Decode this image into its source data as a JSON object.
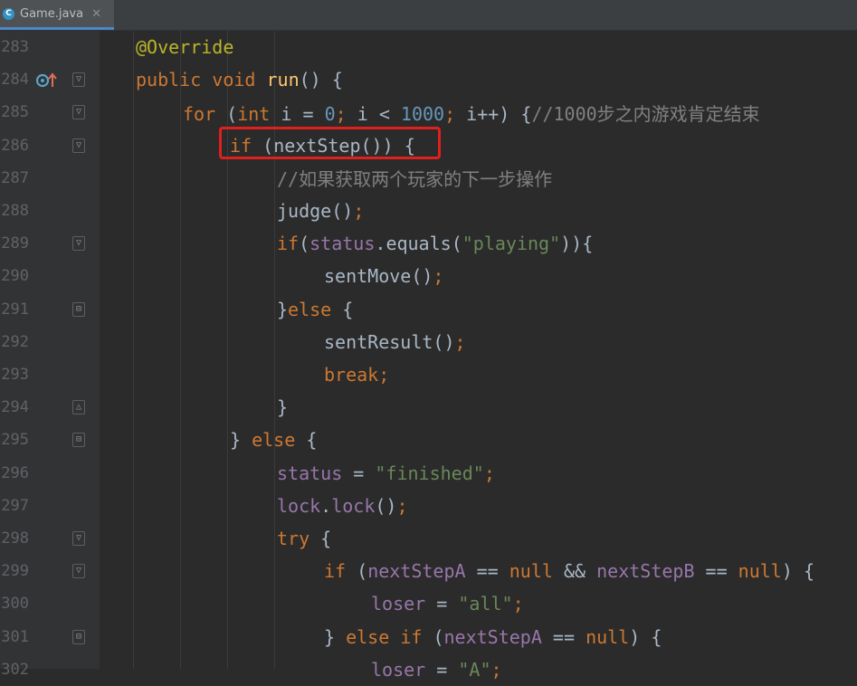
{
  "tab": {
    "icon": "class-c-icon",
    "title": "Game.java",
    "close": "✕"
  },
  "lines": [
    {
      "n": "283",
      "text": "@Override"
    },
    {
      "n": "284",
      "text": "public void run() {"
    },
    {
      "n": "285",
      "text": "for (int i = 0; i < 1000; i++) {//1000步之内游戏肯定结束"
    },
    {
      "n": "286",
      "text": "if (nextStep()) {"
    },
    {
      "n": "287",
      "text": "//如果获取两个玩家的下一步操作"
    },
    {
      "n": "288",
      "text": "judge();"
    },
    {
      "n": "289",
      "text": "if(status.equals(\"playing\")){"
    },
    {
      "n": "290",
      "text": "sentMove();"
    },
    {
      "n": "291",
      "text": "}else {"
    },
    {
      "n": "292",
      "text": "sentResult();"
    },
    {
      "n": "293",
      "text": "break;"
    },
    {
      "n": "294",
      "text": "}"
    },
    {
      "n": "295",
      "text": "} else {"
    },
    {
      "n": "296",
      "text": "status = \"finished\";"
    },
    {
      "n": "297",
      "text": "lock.lock();"
    },
    {
      "n": "298",
      "text": "try {"
    },
    {
      "n": "299",
      "text": "if (nextStepA == null && nextStepB == null) {"
    },
    {
      "n": "300",
      "text": "loser = \"all\";"
    },
    {
      "n": "301",
      "text": "} else if (nextStepA == null) {"
    },
    {
      "n": "302",
      "text": "loser = \"A\";"
    }
  ],
  "colors": {
    "accent_tab": "#4a88c7",
    "highlight": "#e0201c"
  }
}
